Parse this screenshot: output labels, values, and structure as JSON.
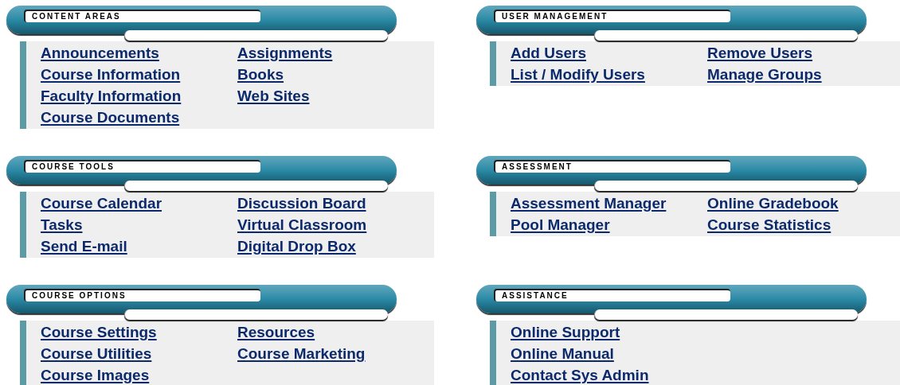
{
  "rows": [
    {
      "sections": [
        {
          "title": "CONTENT AREAS",
          "columns": [
            [
              "Announcements",
              "Course Information",
              "Faculty Information",
              "Course Documents"
            ],
            [
              "Assignments",
              "Books",
              "Web Sites"
            ]
          ]
        },
        {
          "title": "USER MANAGEMENT",
          "columns": [
            [
              "Add Users",
              "List / Modify Users"
            ],
            [
              "Remove Users",
              "Manage Groups"
            ]
          ]
        }
      ]
    },
    {
      "sections": [
        {
          "title": "COURSE TOOLS",
          "columns": [
            [
              "Course Calendar",
              "Tasks",
              "Send E-mail"
            ],
            [
              "Discussion Board",
              "Virtual Classroom",
              "Digital Drop Box"
            ]
          ]
        },
        {
          "title": "ASSESSMENT",
          "columns": [
            [
              "Assessment Manager",
              "Pool Manager"
            ],
            [
              "Online Gradebook",
              "Course Statistics"
            ]
          ]
        }
      ]
    },
    {
      "sections": [
        {
          "title": "COURSE OPTIONS",
          "columns": [
            [
              "Course Settings",
              "Course Utilities",
              "Course Images"
            ],
            [
              "Resources",
              "Course Marketing"
            ]
          ]
        },
        {
          "title": "ASSISTANCE",
          "columns": [
            [
              "Online Support",
              "Online Manual",
              "Contact Sys Admin"
            ]
          ]
        }
      ]
    }
  ]
}
